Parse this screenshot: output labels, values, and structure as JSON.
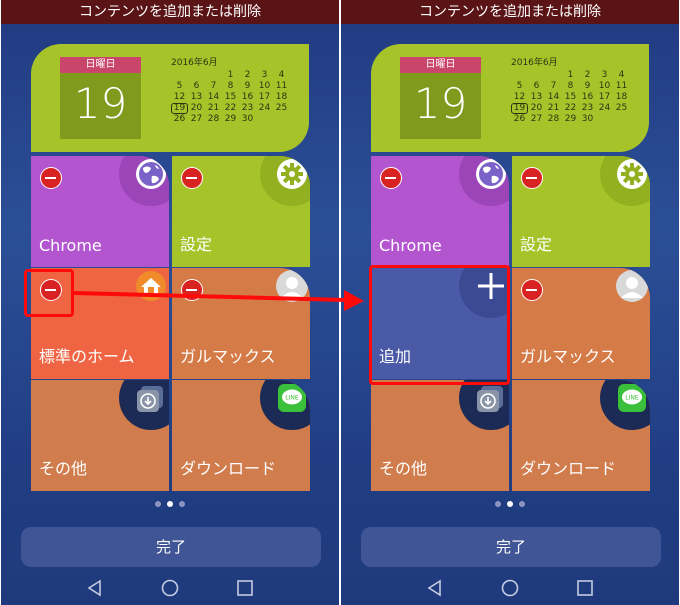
{
  "screens": {
    "left": {
      "title": "コンテンツを追加または削除",
      "calendar": {
        "day_of_week": "日曜日",
        "date": "19",
        "month_label": "2016年6月",
        "weeks": [
          [
            "",
            "",
            "",
            "1",
            "2",
            "3",
            "4"
          ],
          [
            "5",
            "6",
            "7",
            "8",
            "9",
            "10",
            "11"
          ],
          [
            "12",
            "13",
            "14",
            "15",
            "16",
            "17",
            "18"
          ],
          [
            "19",
            "20",
            "21",
            "22",
            "23",
            "24",
            "25"
          ],
          [
            "26",
            "27",
            "28",
            "29",
            "30",
            "",
            ""
          ]
        ],
        "today": "19"
      },
      "tiles": [
        {
          "label": "Chrome",
          "icon": "globe-icon"
        },
        {
          "label": "設定",
          "icon": "gear-icon"
        },
        {
          "label": "標準のホーム",
          "icon": "home-icon"
        },
        {
          "label": "ガルマックス",
          "icon": "contact-avatar-icon"
        },
        {
          "label": "その他",
          "icon": "download-stack-icon"
        },
        {
          "label": "ダウンロード",
          "icon": "line-app-icon"
        }
      ],
      "done_label": "完了"
    },
    "right": {
      "title": "コンテンツを追加または削除",
      "calendar": {
        "day_of_week": "日曜日",
        "date": "19",
        "month_label": "2016年6月",
        "weeks": [
          [
            "",
            "",
            "",
            "1",
            "2",
            "3",
            "4"
          ],
          [
            "5",
            "6",
            "7",
            "8",
            "9",
            "10",
            "11"
          ],
          [
            "12",
            "13",
            "14",
            "15",
            "16",
            "17",
            "18"
          ],
          [
            "19",
            "20",
            "21",
            "22",
            "23",
            "24",
            "25"
          ],
          [
            "26",
            "27",
            "28",
            "29",
            "30",
            "",
            ""
          ]
        ],
        "today": "19"
      },
      "tiles": [
        {
          "label": "Chrome",
          "icon": "globe-icon"
        },
        {
          "label": "設定",
          "icon": "gear-icon"
        },
        {
          "label": "追加",
          "icon": "plus-icon"
        },
        {
          "label": "ガルマックス",
          "icon": "contact-avatar-icon"
        },
        {
          "label": "その他",
          "icon": "download-stack-icon"
        },
        {
          "label": "ダウンロード",
          "icon": "line-app-icon"
        }
      ],
      "done_label": "完了"
    }
  },
  "line_icon_text": "LINE",
  "pager": {
    "pages": 3,
    "current_page": 2
  },
  "colors": {
    "title_bar": "#5a1416",
    "highlight": "#ff0a0a",
    "remove_badge": "#d92323",
    "tile_chrome": "#b255cf",
    "tile_settings": "#a6c42a",
    "tile_home": "#ef6442",
    "tile_galmax": "#d57b48",
    "tile_other": "#d07c4c",
    "tile_add": "#4a5aa7"
  }
}
